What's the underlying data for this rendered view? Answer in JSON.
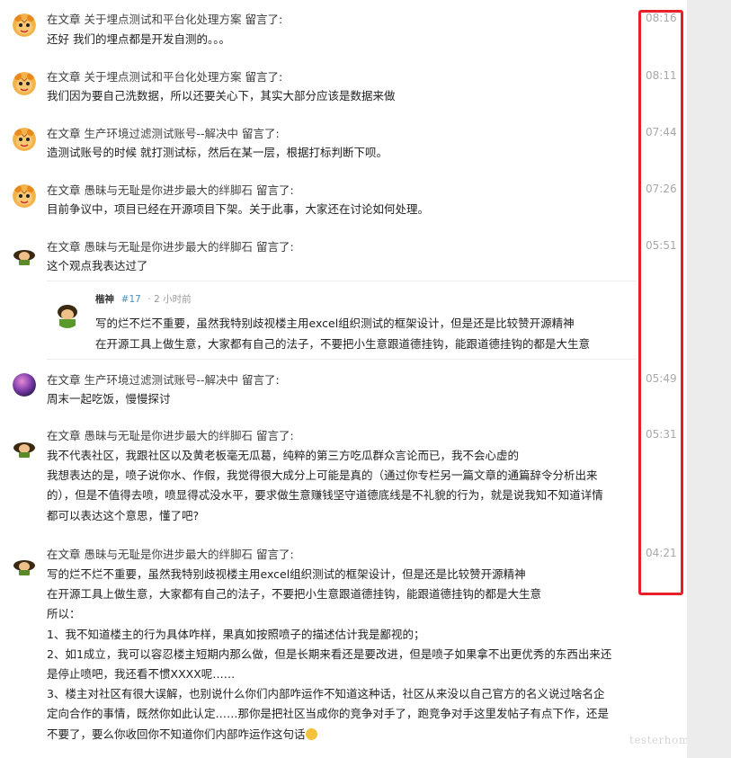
{
  "feed": [
    {
      "user": "在文章",
      "title": "关于埋点测试和平台化处理方案",
      "suffix": "留言了:",
      "lines": [
        "还好 我们的埋点都是开发自测的。。。"
      ],
      "time": "08:16",
      "avatar": "tiger-avatar"
    },
    {
      "user": "在文章",
      "title": "关于埋点测试和平台化处理方案",
      "suffix": "留言了:",
      "lines": [
        "我们因为要自己洗数据，所以还要关心下，其实大部分应该是数据来做"
      ],
      "time": "08:11",
      "avatar": "tiger-avatar"
    },
    {
      "user": "在文章",
      "title": "生产环境过滤测试账号--解决中",
      "suffix": "留言了:",
      "lines": [
        "造测试账号的时候 就打测试标，然后在某一层，根据打标判断下呗。"
      ],
      "time": "07:44",
      "avatar": "tiger-avatar"
    },
    {
      "user": "在文章",
      "title": "愚昧与无耻是你进步最大的绊脚石",
      "suffix": "留言了:",
      "lines": [
        "目前争议中，项目已经在开源项目下架。关于此事，大家还在讨论如何处理。"
      ],
      "time": "07:26",
      "avatar": "tiger-avatar"
    },
    {
      "user": "在文章",
      "title": "愚昧与无耻是你进步最大的绊脚石",
      "suffix": "留言了:",
      "lines": [
        "这个观点我表达过了"
      ],
      "time": "05:51",
      "avatar": "cartoon-avatar"
    },
    {
      "user": "在文章",
      "title": "生产环境过滤测试账号--解决中",
      "suffix": "留言了:",
      "lines": [
        "周末一起吃饭，慢慢探讨"
      ],
      "time": "05:49",
      "avatar": "purple-avatar"
    },
    {
      "user": "在文章",
      "title": "愚昧与无耻是你进步最大的绊脚石",
      "suffix": "留言了:",
      "lines": [
        "我不代表社区，我跟社区以及黄老板毫无瓜葛，纯粹的第三方吃瓜群众言论而已，我不会心虚的",
        "我想表达的是，喷子说你水、作假，我觉得很大成分上可能是真的（通过你专栏另一篇文章的通篇辞令分析出来",
        "的），但是不值得去喷，喷显得忒没水平，要求做生意赚钱坚守道德底线是不礼貌的行为，就是说我知不知道详情",
        "都可以表达这个意思，懂了吧?"
      ],
      "time": "05:31",
      "avatar": "cartoon-avatar"
    },
    {
      "user": "在文章",
      "title": "愚昧与无耻是你进步最大的绊脚石",
      "suffix": "留言了:",
      "lines": [
        "写的烂不烂不重要，虽然我特别歧视楼主用excel组织测试的框架设计，但是还是比较赞开源精神",
        "在开源工具上做生意，大家都有自己的法子，不要把小生意跟道德挂钩，能跟道德挂钩的都是大生意",
        "所以：",
        "1、我不知道楼主的行为具体咋样，果真如按照喷子的描述估计我是鄙视的；",
        "2、如1成立，我可以容忍楼主短期内那么做，但是长期来看还是要改进，但是喷子如果拿不出更优秀的东西出来还",
        "是停止喷吧，我还看不惯XXXX呢……",
        "3、楼主对社区有很大误解，也别说什么你们内部咋运作不知道这种话，社区从来没以自己官方的名义说过啥名企",
        "定向合作的事情，既然你如此认定……那你是把社区当成你的竞争对手了，跑竞争对手这里发帖子有点下作，还是",
        "不要了，要么你收回你不知道你们内部咋运作这句话"
      ],
      "time": "04:21",
      "avatar": "cartoon-avatar"
    }
  ],
  "quote": {
    "name": "楷神",
    "floor": "#17",
    "ago": "· 2 小时前",
    "lines": [
      "写的烂不烂不重要，虽然我特别歧视楼主用excel组织测试的框架设计，但是还是比较赞开源精神",
      "在开源工具上做生意，大家都有自己的法子，不要把小生意跟道德挂钩，能跟道德挂钩的都是大生意"
    ]
  },
  "watermark": "testerhome.com",
  "colors": {
    "highlight": "#e8202a",
    "time": "#a8a8a8",
    "scrollbar": "#ececec"
  }
}
